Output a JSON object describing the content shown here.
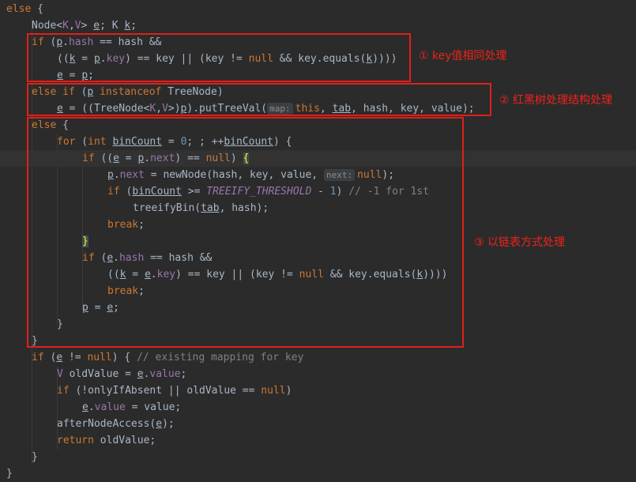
{
  "code": {
    "l1": {
      "kw": "else",
      "rest": " {"
    },
    "l2": {
      "a": "Node<",
      "k": "K",
      "c": ",",
      "v": "V",
      "b": "> ",
      "e": "e",
      "s": "; K ",
      "kk": "k",
      "end": ";"
    },
    "l3": {
      "kw": "if",
      "a": " (",
      "p": "p",
      "dot": ".",
      "f": "hash",
      "rest": " == hash &&"
    },
    "l4": {
      "a": "((",
      "k": "k",
      "b": " = ",
      "p": "p",
      "dot": ".",
      "f": "key",
      "c": ") == key || (key != ",
      "nul": "null",
      "d": " && key.equals(",
      "k2": "k",
      "end": "))))"
    },
    "l5": {
      "e": "e",
      "a": " = ",
      "p": "p",
      "end": ";"
    },
    "l6": {
      "kw": "else if",
      "a": " (",
      "p": "p",
      "b": " ",
      "kw2": "instanceof",
      "c": " TreeNode)"
    },
    "l7": {
      "e": "e",
      "a": " = ((TreeNode<",
      "k": "K",
      "c": ",",
      "v": "V",
      "b": ">)",
      "p": "p",
      "d": ").putTreeVal(",
      "hint": "map:",
      "th": "this",
      "x": ", ",
      "tab": "tab",
      "end": ", hash, key, value);"
    },
    "l8": {
      "kw": "else",
      "rest": " {"
    },
    "l9": {
      "kw": "for",
      "a": " (",
      "kw2": "int",
      "b": " ",
      "bc": "binCount",
      "c": " = ",
      "n": "0",
      "d": "; ; ++",
      "bc2": "binCount",
      "end": ") {"
    },
    "l10": {
      "kw": "if",
      "a": " ((",
      "e": "e",
      "b": " = ",
      "p": "p",
      "dot": ".",
      "f": "next",
      "c": ") == ",
      "nul": "null",
      "d": ") ",
      "br": "{"
    },
    "l11": {
      "p": "p",
      "dot": ".",
      "f": "next",
      "a": " = newNode(hash, key, value, ",
      "hint": "next:",
      "nul": "null",
      "end": ");"
    },
    "l12": {
      "kw": "if",
      "a": " (",
      "bc": "binCount",
      "b": " >= ",
      "c": "TREEIFY_THRESHOLD",
      "d": " - ",
      "n": "1",
      "e": ") ",
      "cmt": "// -1 for 1st"
    },
    "l13": {
      "a": "treeifyBin(",
      "tab": "tab",
      "end": ", hash);"
    },
    "l14": {
      "kw": "break",
      "end": ";"
    },
    "l15": {
      "br": "}"
    },
    "l16": {
      "kw": "if",
      "a": " (",
      "e": "e",
      "dot": ".",
      "f": "hash",
      "rest": " == hash &&"
    },
    "l17": {
      "a": "((",
      "k": "k",
      "b": " = ",
      "e": "e",
      "dot": ".",
      "f": "key",
      "c": ") == key || (key != ",
      "nul": "null",
      "d": " && key.equals(",
      "k2": "k",
      "end": "))))"
    },
    "l18": {
      "kw": "break",
      "end": ";"
    },
    "l19": {
      "p": "p",
      "a": " = ",
      "e": "e",
      "end": ";"
    },
    "l20": {
      "br": "}"
    },
    "l21": {
      "br": "}"
    },
    "l22": {
      "kw": "if",
      "a": " (",
      "e": "e",
      "b": " != ",
      "nul": "null",
      "c": ") { ",
      "cmt": "// existing mapping for key"
    },
    "l23": {
      "v": "V",
      "a": " oldValue = ",
      "e": "e",
      "dot": ".",
      "f": "value",
      "end": ";"
    },
    "l24": {
      "kw": "if",
      "a": " (!",
      "f": "onlyIfAbsent",
      "b": " || oldValue == ",
      "nul": "null",
      "end": ")"
    },
    "l25": {
      "e": "e",
      "dot": ".",
      "f": "value",
      "end": " = value;"
    },
    "l26": {
      "a": "afterNodeAccess(",
      "e": "e",
      "end": ");"
    },
    "l27": {
      "kw": "return",
      "end": " oldValue;"
    },
    "l28": {
      "br": "}"
    },
    "l29": {
      "br": "}"
    }
  },
  "annotations": {
    "a1": "① key值相同处理",
    "a2": "② 红黑树处理结构处理",
    "a3": "③ 以链表方式处理"
  }
}
